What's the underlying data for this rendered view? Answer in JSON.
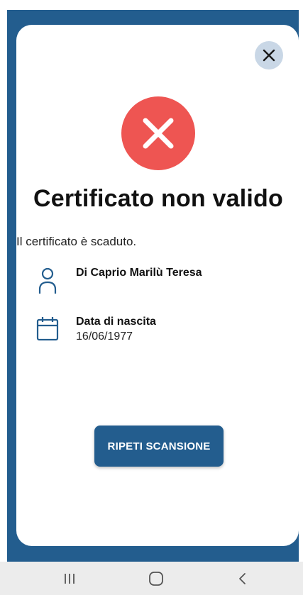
{
  "dialog": {
    "title": "Certificato non valido",
    "message": "Il certificato è scaduto.",
    "close_icon": "close-icon",
    "status_icon": "error-x-icon",
    "status_color": "#ee5552"
  },
  "holder": {
    "icon": "person-icon",
    "name": "Di Caprio Marilù Teresa"
  },
  "birth": {
    "icon": "calendar-icon",
    "label": "Data di nascita",
    "value": "16/06/1977"
  },
  "actions": {
    "repeat_label": "RIPETI SCANSIONE"
  },
  "navbar": {
    "items": [
      "recent-apps-icon",
      "home-icon",
      "back-icon"
    ]
  },
  "colors": {
    "brand_blue": "#235d8e",
    "close_bg": "#c9d7e6",
    "error_red": "#ee5552"
  }
}
